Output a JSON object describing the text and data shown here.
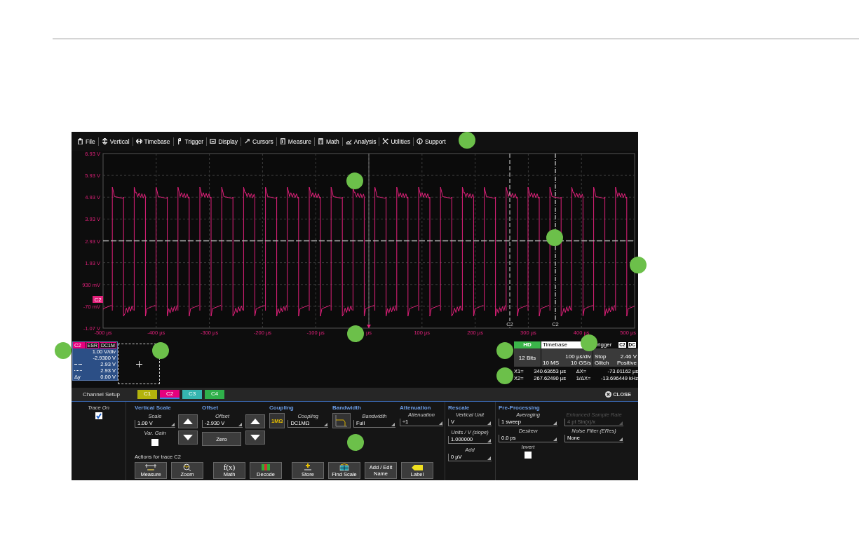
{
  "menu": [
    {
      "label": "File"
    },
    {
      "label": "Vertical"
    },
    {
      "label": "Timebase"
    },
    {
      "label": "Trigger"
    },
    {
      "label": "Display"
    },
    {
      "label": "Cursors"
    },
    {
      "label": "Measure"
    },
    {
      "label": "Math"
    },
    {
      "label": "Analysis"
    },
    {
      "label": "Utilities"
    },
    {
      "label": "Support"
    }
  ],
  "plot": {
    "y_labels": [
      "6.93 V",
      "5.93 V",
      "4.93 V",
      "3.93 V",
      "2.93 V",
      "1.93 V",
      "930 mV",
      "-70 mV",
      "-1.07 V"
    ],
    "x_labels": [
      "-500 µs",
      "-400 µs",
      "-300 µs",
      "-200 µs",
      "-100 µs",
      "µs",
      "100 µs",
      "200 µs",
      "300 µs",
      "400 µs",
      "500 µs"
    ],
    "trace_tag": "C2",
    "cursor_labels": [
      "C2",
      "C2"
    ]
  },
  "trace_descriptor": {
    "channel": "C2",
    "badges": [
      "ESR",
      "DC1M"
    ],
    "rows": [
      {
        "kind": "plain",
        "value": "1.00 V/div"
      },
      {
        "kind": "plain",
        "value": "-2.9300 V"
      },
      {
        "kind": "dashdot",
        "value": "2.93 V"
      },
      {
        "kind": "dotted",
        "value": "2.93 V"
      },
      {
        "kind": "delta",
        "label": "Δy",
        "value": "0.00 V"
      }
    ]
  },
  "acquisition": {
    "mode": "HD",
    "bits": "12 Bits",
    "timebase_header": "Timebase",
    "timebase_scale": "100 µs/div",
    "memory": "10 MS",
    "sample_rate": "10 GS/s",
    "trigger_header": "rigger",
    "trigger_badges": [
      "C2",
      "DC"
    ],
    "trigger_state": "Stop",
    "trigger_level": "2.46 V",
    "trigger_type": "Glitch",
    "trigger_slope": "Positive"
  },
  "cursor_readout": [
    [
      "X1=",
      "340.63653 µs",
      "ΔX=",
      "-73.01162 µs"
    ],
    [
      "X2=",
      "267.62490 µs",
      "1/ΔX=",
      "-13.696449 kHz"
    ]
  ],
  "setup_bar": {
    "title": "Channel Setup",
    "tabs": [
      {
        "label": "C1",
        "color": "#b3b30c",
        "selected": false
      },
      {
        "label": "C2",
        "color": "#e6007e",
        "selected": true
      },
      {
        "label": "C3",
        "color": "#35b5b0",
        "selected": false
      },
      {
        "label": "C4",
        "color": "#2fb04a",
        "selected": false
      }
    ],
    "close": "CLOSE"
  },
  "panel": {
    "trace_on": {
      "label": "Trace On",
      "checked": true
    },
    "vertical_scale": {
      "heading": "Vertical Scale",
      "field": {
        "label": "Scale",
        "value": "1.00 V",
        "disabled": false
      },
      "var_gain": {
        "label": "Var. Gain",
        "checked": false
      }
    },
    "offset": {
      "heading": "Offset",
      "field": {
        "label": "Offset",
        "value": "-2.930 V",
        "disabled": false
      },
      "zero": "Zero"
    },
    "coupling": {
      "heading": "Coupling",
      "icon_text": "1MΩ",
      "field": {
        "label": "Coupling",
        "value": "DC1MΩ",
        "disabled": false
      }
    },
    "bandwidth": {
      "heading": "Bandwidth",
      "field": {
        "label": "Bandwidth",
        "value": "Full",
        "disabled": false
      }
    },
    "attenuation": {
      "heading": "Attenuation",
      "field": {
        "label": "Attenuation",
        "value": "÷1",
        "disabled": false
      }
    },
    "actions": {
      "title": "Actions for trace C2",
      "buttons": [
        {
          "label": "Measure"
        },
        {
          "label": "Zoom"
        },
        {
          "label": "Math",
          "icon_text": "f(x)"
        },
        {
          "label": "Decode"
        },
        {
          "label": "Store"
        },
        {
          "label": "Find Scale"
        },
        {
          "label": "Add / Edit Name"
        },
        {
          "label": "Label"
        }
      ]
    },
    "rescale": {
      "heading": "Rescale",
      "fields": [
        {
          "label": "Vertical Unit",
          "value": "V",
          "disabled": false
        },
        {
          "label": "Units / V (slope)",
          "value": "1.000000",
          "disabled": false
        },
        {
          "label": "Add",
          "value": "0 µV",
          "disabled": false
        }
      ]
    },
    "pre_processing": {
      "heading": "Pre-Processing",
      "fields": [
        {
          "label": "Averaging",
          "value": "1 sweep",
          "disabled": false
        },
        {
          "label": "Deskew",
          "value": "0.0 ps",
          "disabled": false
        }
      ],
      "invert": {
        "label": "Invert",
        "checked": false
      },
      "extra_fields": [
        {
          "label": "Enhanced Sample Rate",
          "value": "4 pt Sin(x)/x",
          "disabled": true
        },
        {
          "label": "Noise Filter (ERes)",
          "value": "None",
          "disabled": false
        }
      ]
    }
  }
}
